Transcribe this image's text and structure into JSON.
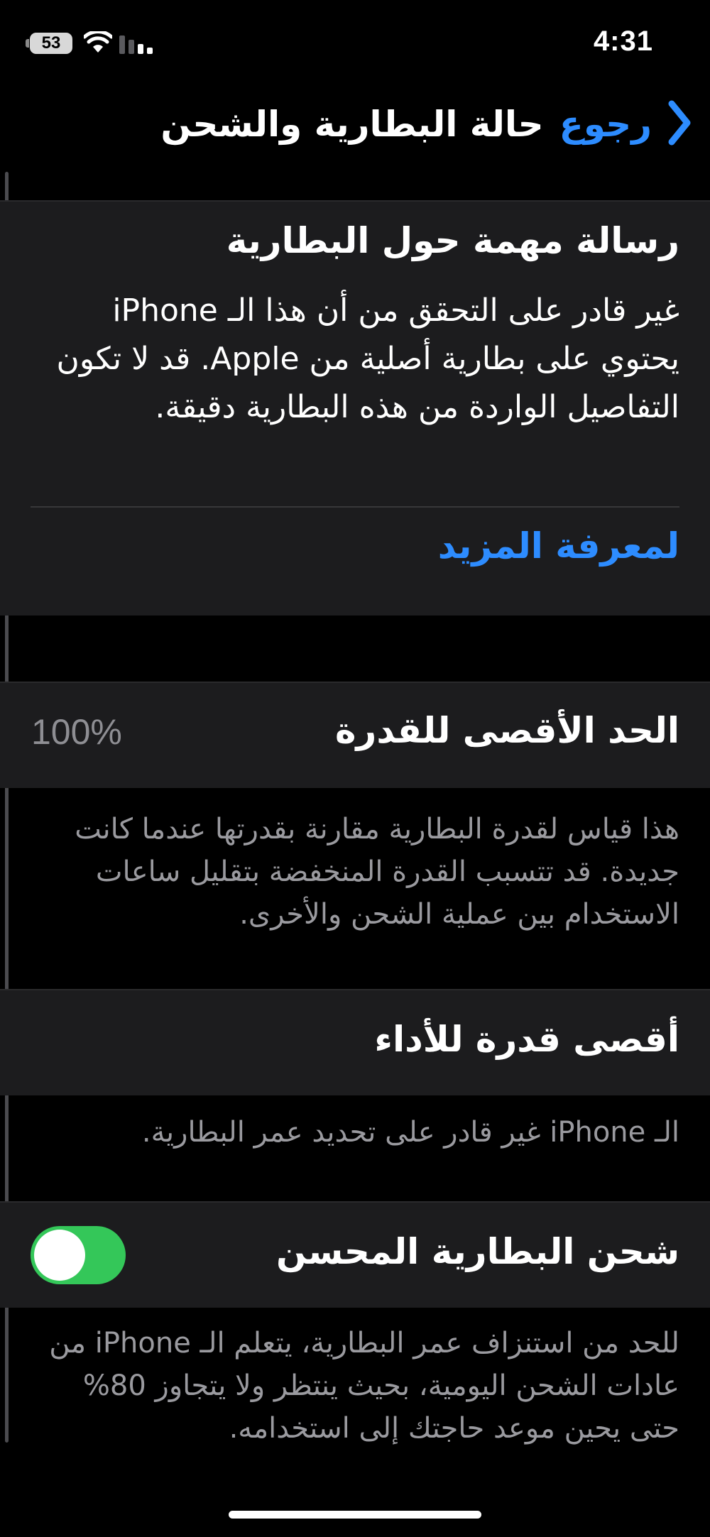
{
  "status_bar": {
    "battery_percent": "53",
    "time": "4:31"
  },
  "nav": {
    "back_label": "رجوع",
    "title": "حالة البطارية والشحن"
  },
  "notice": {
    "title": "رسالة مهمة حول البطارية",
    "body": "غير قادر على التحقق من أن هذا الـ iPhone يحتوي على بطارية أصلية من Apple. قد لا تكون التفاصيل الواردة من هذه البطارية دقيقة.",
    "learn_more_label": "لمعرفة المزيد"
  },
  "maximum_capacity": {
    "label": "الحد الأقصى للقدرة",
    "value": "100%",
    "footnote": "هذا قياس لقدرة البطارية مقارنة بقدرتها عندما كانت جديدة. قد تتسبب القدرة المنخفضة بتقليل ساعات الاستخدام بين عملية الشحن والأخرى."
  },
  "peak_performance": {
    "label": "أقصى قدرة للأداء",
    "footnote": "الـ iPhone غير قادر على تحديد عمر البطارية."
  },
  "optimized_charging": {
    "label": "شحن البطارية المحسن",
    "enabled": true,
    "footnote": "للحد من استنزاف عمر البطارية، يتعلم الـ iPhone من عادات الشحن اليومية، بحيث ينتظر ولا يتجاوز 80% حتى يحين موعد حاجتك إلى استخدامه."
  },
  "icons": {
    "back": "chevron-left-icon",
    "wifi": "wifi-icon",
    "signal": "cellular-signal-icon",
    "battery": "battery-icon"
  },
  "colors": {
    "accent": "#2d8cff",
    "toggle_on": "#34c759",
    "background": "#000000",
    "card": "#1c1c1e",
    "secondary_text": "#9a9a9f"
  }
}
